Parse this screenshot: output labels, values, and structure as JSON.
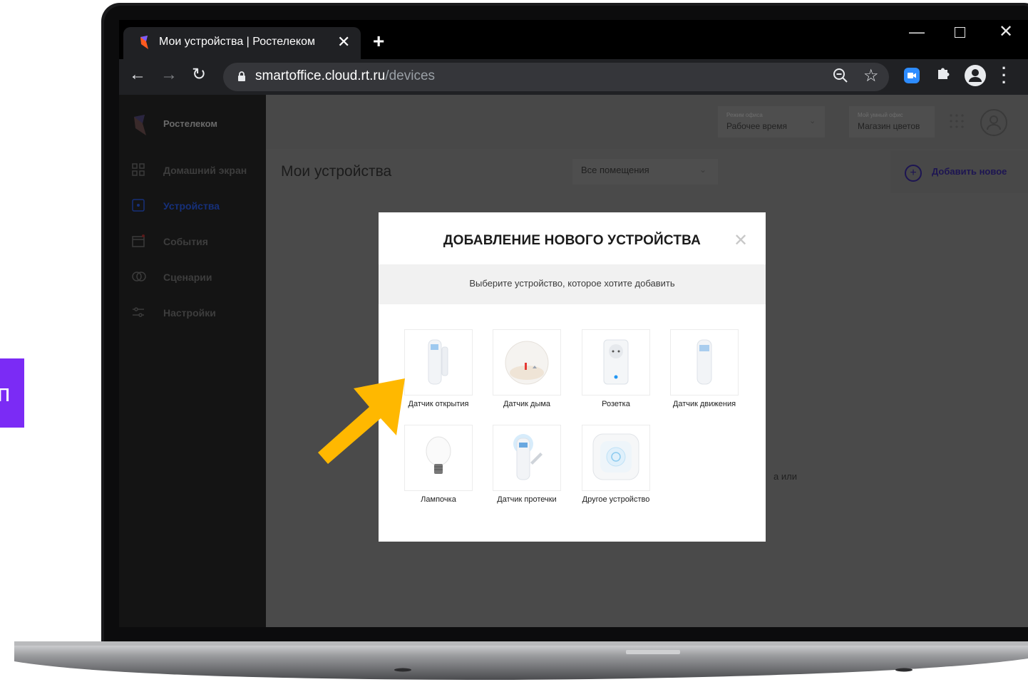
{
  "browser": {
    "tab_title": "Мои устройства | Ростелеком",
    "tab_close": "✕",
    "new_tab": "+",
    "url_host": "smartoffice.cloud.rt.ru",
    "url_path": "/devices"
  },
  "sidebar": {
    "brand": "Ростелеком",
    "items": [
      {
        "label": "Домашний экран",
        "icon": "grid-icon"
      },
      {
        "label": "Устройства",
        "icon": "device-icon",
        "active": true
      },
      {
        "label": "События",
        "icon": "calendar-icon"
      },
      {
        "label": "Сценарии",
        "icon": "scenario-icon"
      },
      {
        "label": "Настройки",
        "icon": "sliders-icon"
      }
    ]
  },
  "header": {
    "mode_caption": "Режим офиса",
    "mode_value": "Рабочее время",
    "office_caption": "Мой умный офис",
    "office_value": "Магазин цветов"
  },
  "main": {
    "title": "Мои устройства",
    "rooms_filter": "Все помещения",
    "add_new": "Добавить новое",
    "background_fragment": "а или"
  },
  "modal": {
    "title": "ДОБАВЛЕНИЕ НОВОГО УСТРОЙСТВА",
    "subtitle": "Выберите устройство, которое хотите добавить",
    "devices": [
      {
        "label": "Датчик открытия"
      },
      {
        "label": "Датчик дыма"
      },
      {
        "label": "Розетка"
      },
      {
        "label": "Датчик движения"
      },
      {
        "label": "Лампочка"
      },
      {
        "label": "Датчик протечки"
      },
      {
        "label": "Другое устройство"
      }
    ]
  },
  "left_tab_glyph": "п",
  "colors": {
    "accent_purple": "#7b2bf5",
    "highlight_arrow": "#ffb800",
    "add_link": "#3b2bb0"
  }
}
